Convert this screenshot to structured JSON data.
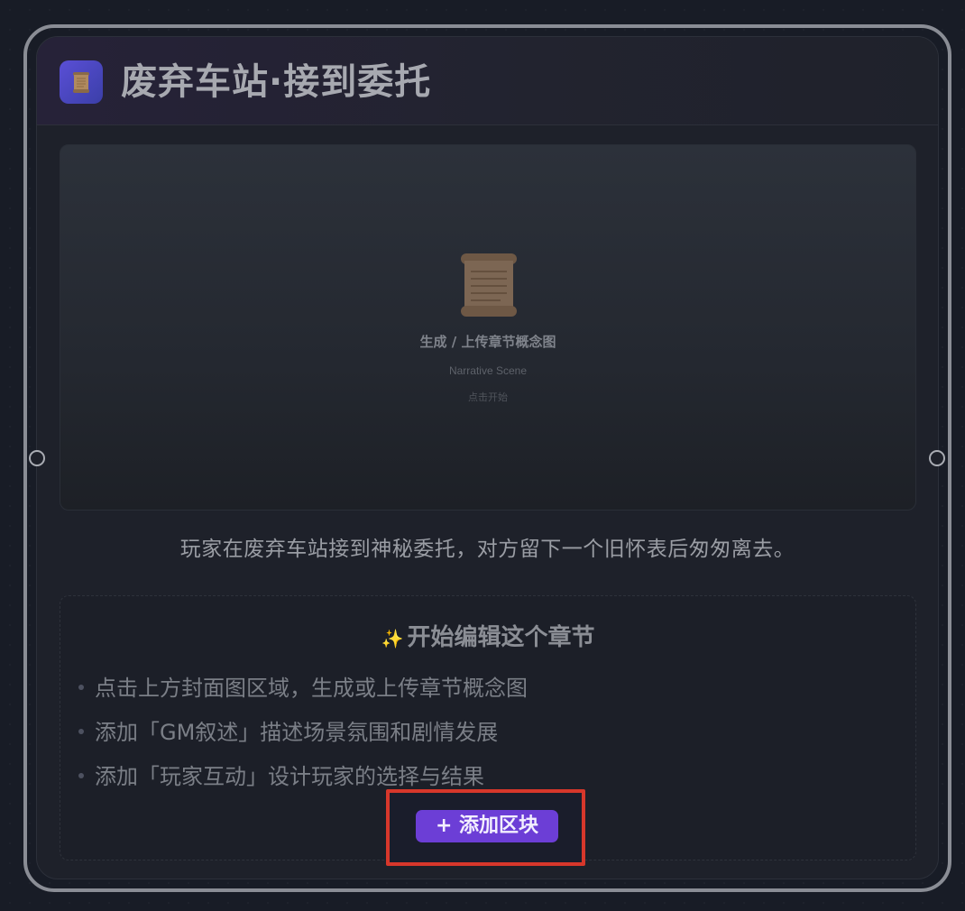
{
  "node": {
    "title": "废弃车站·接到委托",
    "icon": "scroll-icon",
    "cover": {
      "title": "生成 / 上传章节概念图",
      "subtitle": "Narrative Scene",
      "hint": "点击开始",
      "icon": "scroll-icon"
    },
    "summary": "玩家在废弃车站接到神秘委托，对方留下一个旧怀表后匆匆离去。",
    "edit_panel": {
      "sparkle_icon": "✨",
      "title": "开始编辑这个章节",
      "tips": [
        "点击上方封面图区域，生成或上传章节概念图",
        "添加「GM叙述」描述场景氛围和剧情发展",
        "添加「玩家互动」设计玩家的选择与结果"
      ],
      "add_button_label": "+ 添加区块"
    }
  },
  "colors": {
    "accent": "#6c3ed6",
    "highlight": "#d7372b",
    "background": "#181c26",
    "card": "#1e212a"
  }
}
